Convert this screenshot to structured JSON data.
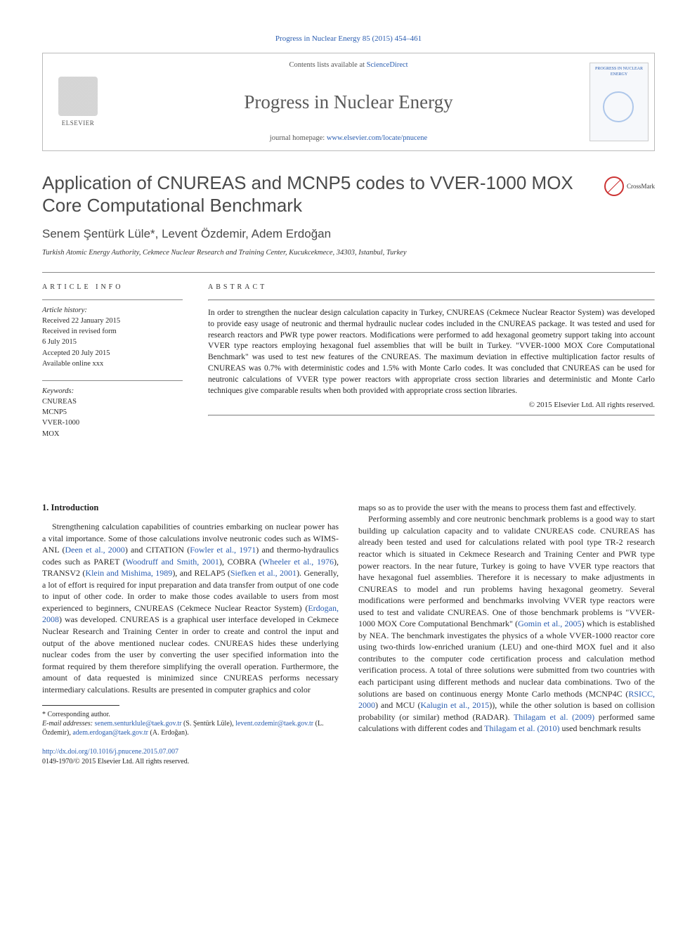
{
  "citation": "Progress in Nuclear Energy 85 (2015) 454–461",
  "header": {
    "contents_prefix": "Contents lists available at ",
    "contents_link": "ScienceDirect",
    "journal_name": "Progress in Nuclear Energy",
    "homepage_prefix": "journal homepage: ",
    "homepage_url": "www.elsevier.com/locate/pnucene",
    "publisher": "ELSEVIER",
    "cover_text": "PROGRESS IN NUCLEAR ENERGY"
  },
  "crossmark_label": "CrossMark",
  "title": "Application of CNUREAS and MCNP5 codes to VVER-1000 MOX Core Computational Benchmark",
  "authors": "Senem Şentürk Lüle*, Levent Özdemir, Adem Erdoğan",
  "affiliation": "Turkish Atomic Energy Authority, Cekmece Nuclear Research and Training Center, Kucukcekmece, 34303, Istanbul, Turkey",
  "article_info": {
    "label": "ARTICLE INFO",
    "history_label": "Article history:",
    "received": "Received 22 January 2015",
    "revised1": "Received in revised form",
    "revised2": "6 July 2015",
    "accepted": "Accepted 20 July 2015",
    "online": "Available online xxx",
    "keywords_label": "Keywords:",
    "keywords": [
      "CNUREAS",
      "MCNP5",
      "VVER-1000",
      "MOX"
    ]
  },
  "abstract": {
    "label": "ABSTRACT",
    "text": "In order to strengthen the nuclear design calculation capacity in Turkey, CNUREAS (Cekmece Nuclear Reactor System) was developed to provide easy usage of neutronic and thermal hydraulic nuclear codes included in the CNUREAS package. It was tested and used for research reactors and PWR type power reactors. Modifications were performed to add hexagonal geometry support taking into account VVER type reactors employing hexagonal fuel assemblies that will be built in Turkey. \"VVER-1000 MOX Core Computational Benchmark\" was used to test new features of the CNUREAS. The maximum deviation in effective multiplication factor results of CNUREAS was 0.7% with deterministic codes and 1.5% with Monte Carlo codes. It was concluded that CNUREAS can be used for neutronic calculations of VVER type power reactors with appropriate cross section libraries and deterministic and Monte Carlo techniques give comparable results when both provided with appropriate cross section libraries.",
    "copyright": "© 2015 Elsevier Ltd. All rights reserved."
  },
  "intro": {
    "heading": "1. Introduction",
    "p1a": "Strengthening calculation capabilities of countries embarking on nuclear power has a vital importance. Some of those calculations involve neutronic codes such as WIMS-ANL (",
    "r1": "Deen et al., 2000",
    "p1b": ") and CITATION (",
    "r2": "Fowler et al., 1971",
    "p1c": ") and thermo-hydraulics codes such as PARET (",
    "r3": "Woodruff and Smith, 2001",
    "p1d": "), COBRA (",
    "r4": "Wheeler et al., 1976",
    "p1e": "), TRANSV2 (",
    "r5": "Klein and Mishima, 1989",
    "p1f": "), and RELAP5 (",
    "r6": "Siefken et al., 2001",
    "p1g": "). Generally, a lot of effort is required for input preparation and data transfer from output of one code to input of other code. In order to make those codes available to users from most experienced to beginners, CNUREAS (Cekmece Nuclear Reactor System) (",
    "r7": "Erdogan, 2008",
    "p1h": ") was developed. CNUREAS is a graphical user interface developed in Cekmece Nuclear Research and Training Center in order to create and control the input and output of the above mentioned nuclear codes. CNUREAS hides these underlying nuclear codes from the user by converting the user specified information into the format required by them therefore simplifying the overall operation. Furthermore, the amount of data requested is minimized since CNUREAS performs necessary intermediary calculations. Results are presented in computer graphics and color ",
    "p1_cont": "maps so as to provide the user with the means to process them fast and effectively.",
    "p2a": "Performing assembly and core neutronic benchmark problems is a good way to start building up calculation capacity and to validate CNUREAS code. CNUREAS has already been tested and used for calculations related with pool type TR-2 research reactor which is situated in Cekmece Research and Training Center and PWR type power reactors. In the near future, Turkey is going to have VVER type reactors that have hexagonal fuel assemblies. Therefore it is necessary to make adjustments in CNUREAS to model and run problems having hexagonal geometry. Several modifications were performed and benchmarks involving VVER type reactors were used to test and validate CNUREAS. One of those benchmark problems is \"VVER-1000 MOX Core Computational Benchmark\" (",
    "r8": "Gomin et al., 2005",
    "p2b": ") which is established by NEA. The benchmark investigates the physics of a whole VVER-1000 reactor core using two-thirds low-enriched uranium (LEU) and one-third MOX fuel and it also contributes to the computer code certification process and calculation method verification process. A total of three solutions were submitted from two countries with each participant using different methods and nuclear data combinations. Two of the solutions are based on continuous energy Monte Carlo methods (MCNP4C (",
    "r9": "RSICC, 2000",
    "p2c": ") and MCU (",
    "r10": "Kalugin et al., 2015",
    "p2d": ")), while the other solution is based on collision probability (or similar) method (RADAR). ",
    "r11": "Thilagam et al. (2009)",
    "p2e": " performed same calculations with different codes and ",
    "r12": "Thilagam et al. (2010)",
    "p2f": " used benchmark results"
  },
  "footnote": {
    "corr": "* Corresponding author.",
    "email_label": "E-mail addresses:",
    "e1": "senem.senturklule@taek.gov.tr",
    "n1": " (S. Şentürk Lüle), ",
    "e2": "levent.ozdemir@taek.gov.tr",
    "n2": " (L. Özdemir), ",
    "e3": "adem.erdogan@taek.gov.tr",
    "n3": " (A. Erdoğan)."
  },
  "doi": {
    "url": "http://dx.doi.org/10.1016/j.pnucene.2015.07.007",
    "issn_line": "0149-1970/© 2015 Elsevier Ltd. All rights reserved."
  }
}
